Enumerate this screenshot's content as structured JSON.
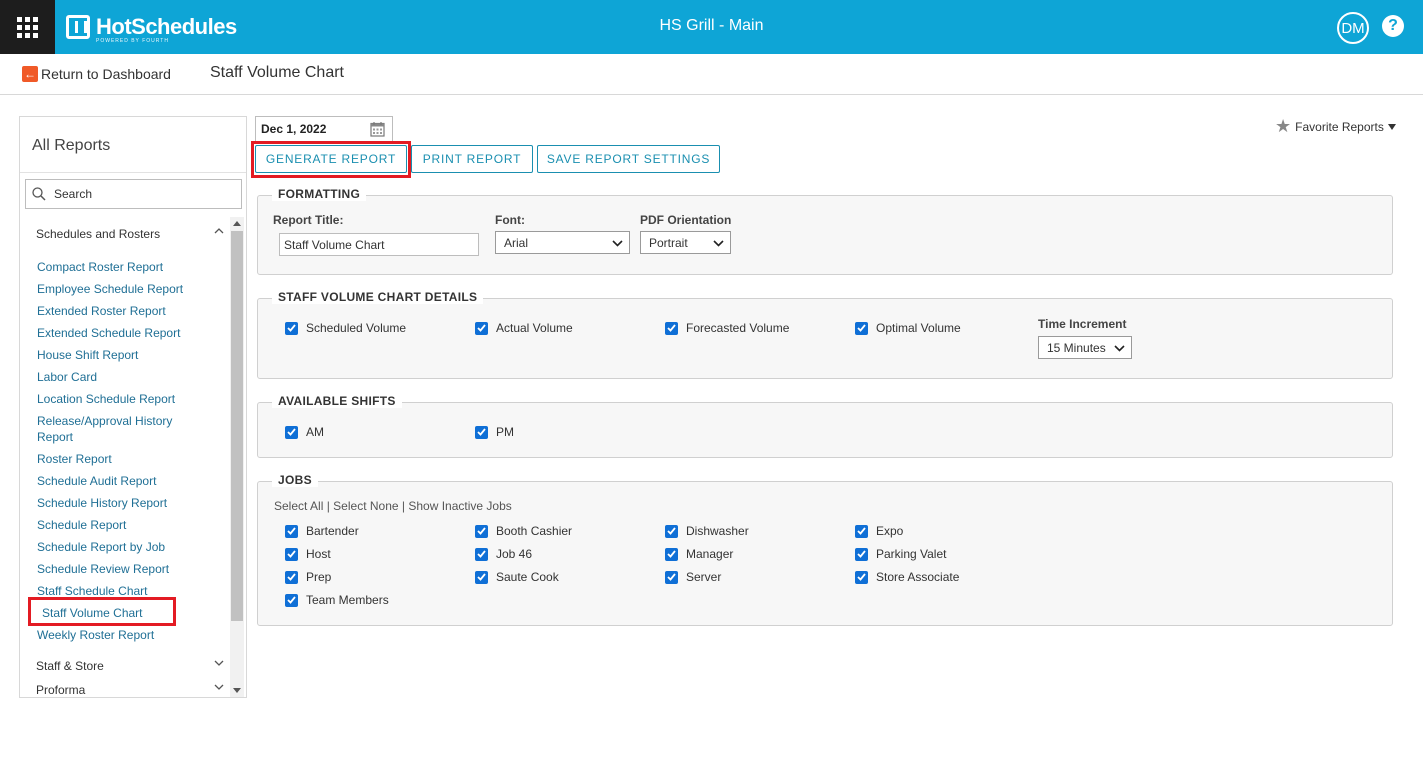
{
  "topbar": {
    "brand": "HotSchedules",
    "brand_sub": "POWERED BY FOURTH",
    "location": "HS Grill - Main",
    "avatar": "DM",
    "help": "?"
  },
  "subheader": {
    "back_label": "Return to Dashboard",
    "title": "Staff Volume Chart"
  },
  "sidebar": {
    "title": "All Reports",
    "search_placeholder": "Search",
    "section_1": "Schedules and Rosters",
    "items": [
      "Compact Roster Report",
      "Employee Schedule Report",
      "Extended Roster Report",
      "Extended Schedule Report",
      "House Shift Report",
      "Labor Card",
      "Location Schedule Report",
      "Release/Approval History",
      "Report",
      "Roster Report",
      "Schedule Audit Report",
      "Schedule History Report",
      "Schedule Report",
      "Schedule Report by Job",
      "Schedule Review Report",
      "Staff Schedule Chart",
      "Staff Volume Chart",
      "Weekly Roster Report"
    ],
    "section_2": "Staff & Store",
    "section_3": "Proforma"
  },
  "toolbar": {
    "date": "Dec 1, 2022",
    "generate": "GENERATE REPORT",
    "print": "PRINT REPORT",
    "save": "SAVE REPORT SETTINGS",
    "favorites": "Favorite Reports"
  },
  "formatting": {
    "legend": "FORMATTING",
    "title_label": "Report Title:",
    "title_value": "Staff Volume Chart",
    "font_label": "Font:",
    "font_value": "Arial",
    "orientation_label": "PDF Orientation",
    "orientation_value": "Portrait"
  },
  "details": {
    "legend": "STAFF VOLUME CHART DETAILS",
    "options": [
      "Scheduled Volume",
      "Actual Volume",
      "Forecasted Volume",
      "Optimal Volume"
    ],
    "increment_label": "Time Increment",
    "increment_value": "15 Minutes"
  },
  "shifts": {
    "legend": "AVAILABLE SHIFTS",
    "options": [
      "AM",
      "PM"
    ]
  },
  "jobs": {
    "legend": "JOBS",
    "select_all": "Select All",
    "select_none": "Select None",
    "show_inactive": "Show Inactive Jobs",
    "separator": "|",
    "options": [
      "Bartender",
      "Booth Cashier",
      "Dishwasher",
      "Expo",
      "Host",
      "Job 46",
      "Manager",
      "Parking Valet",
      "Prep",
      "Saute Cook",
      "Server",
      "Store Associate",
      "Team Members"
    ]
  },
  "colors": {
    "topbar": "#0ea5d6",
    "accent": "#1a8fb0",
    "link": "#1f6f95",
    "highlight": "#e31b23",
    "checkbox": "#0f6fd6"
  }
}
